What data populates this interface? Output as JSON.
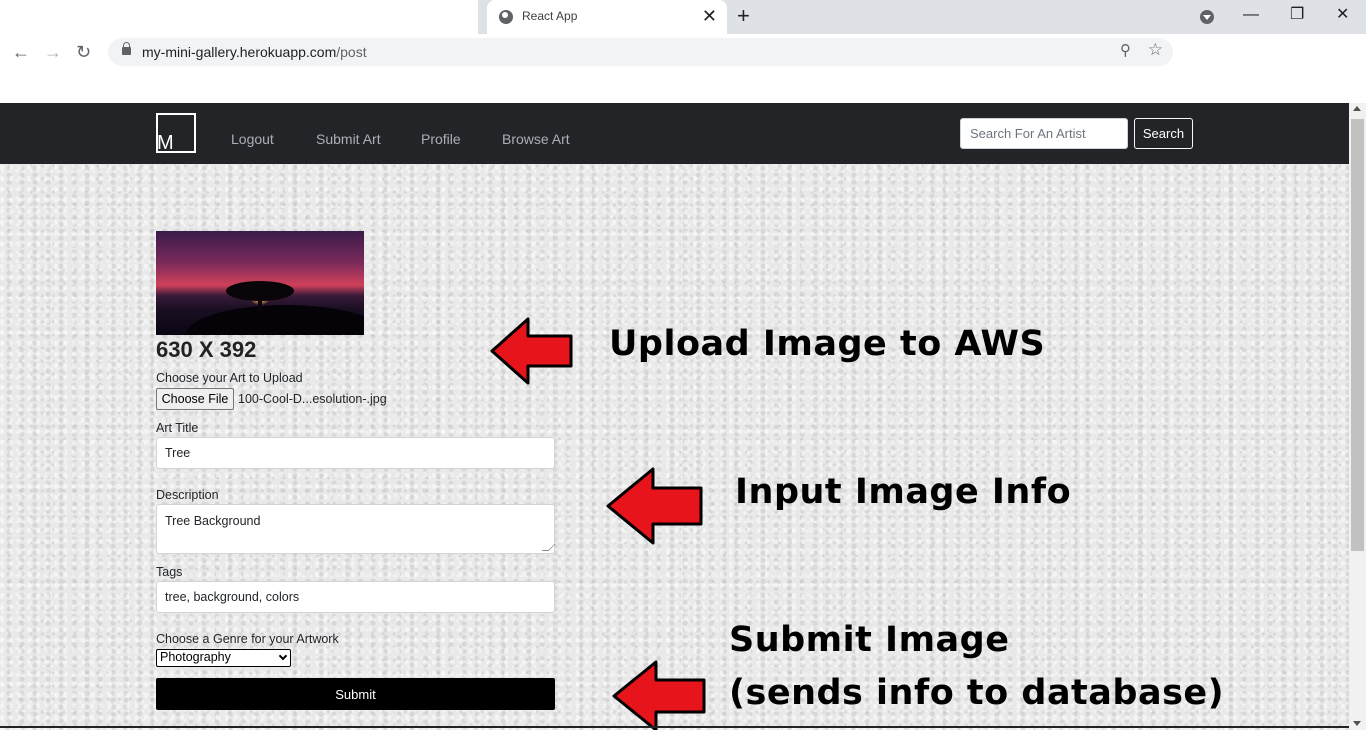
{
  "browser": {
    "tab_title": "React App",
    "tab_close": "✕",
    "new_tab": "+",
    "url_host": "my-mini-gallery.herokuapp.com",
    "url_path": "/post",
    "window_controls": {
      "minimize": "—",
      "restore": "❐",
      "close": "✕"
    },
    "nav": {
      "back": "←",
      "forward": "→",
      "reload": "↻"
    },
    "zoom_icon": "⚲",
    "bookmark_icon": "☆"
  },
  "navbar": {
    "logo_letter": "M",
    "links": [
      "Logout",
      "Submit Art",
      "Profile",
      "Browse Art"
    ],
    "search_placeholder": "Search For An Artist",
    "search_button": "Search"
  },
  "form": {
    "image_dimensions": "630 X 392",
    "upload_label": "Choose your Art to Upload",
    "choose_file_button": "Choose File",
    "file_name": "100-Cool-D...esolution-.jpg",
    "title_label": "Art Title",
    "title_value": "Tree",
    "description_label": "Description",
    "description_value": "Tree Background",
    "tags_label": "Tags",
    "tags_value": "tree, background, colors",
    "genre_label": "Choose a Genre for your Artwork",
    "genre_selected": "Photography",
    "submit_button": "Submit"
  },
  "annotations": {
    "upload": "Upload Image to AWS",
    "input_info": "Input Image Info",
    "submit_line1": "Submit Image",
    "submit_line2": "(sends info to database)",
    "arrow_color": "#e8141c"
  }
}
